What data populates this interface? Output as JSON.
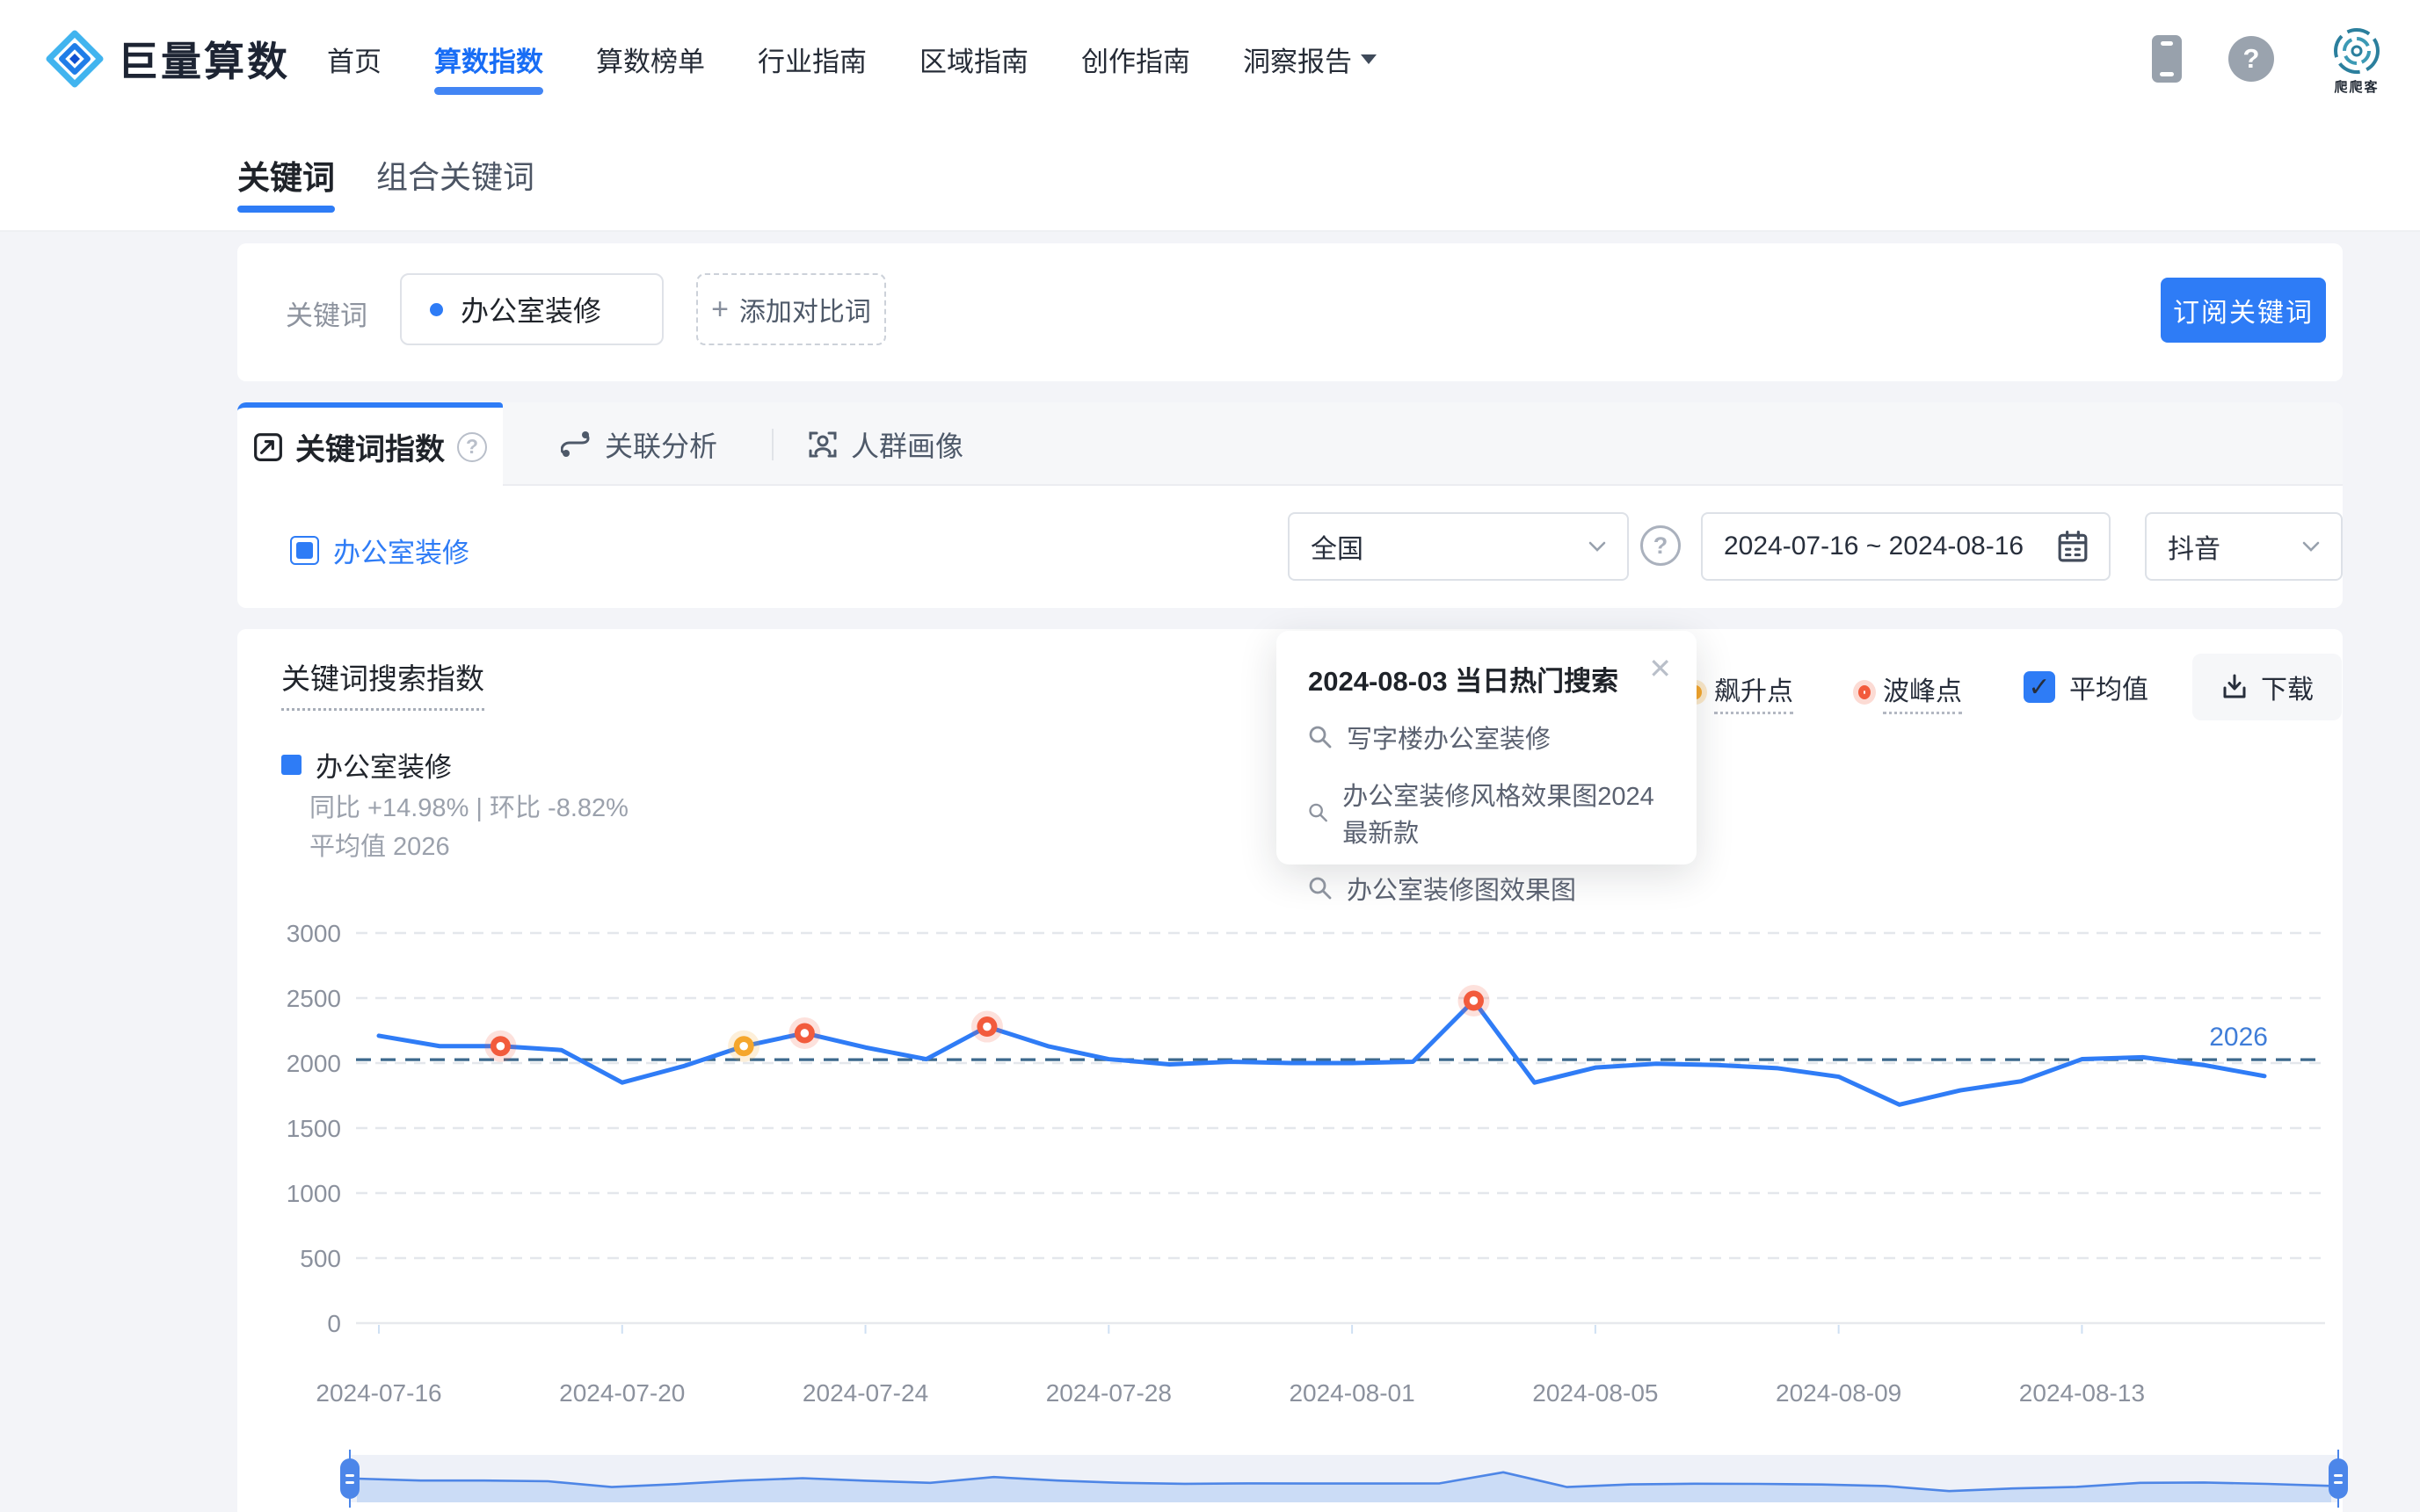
{
  "header": {
    "logo_text": "巨量算数",
    "nav_items": [
      {
        "label": "首页",
        "active": false
      },
      {
        "label": "算数指数",
        "active": true
      },
      {
        "label": "算数榜单",
        "active": false
      },
      {
        "label": "行业指南",
        "active": false
      },
      {
        "label": "区域指南",
        "active": false
      },
      {
        "label": "创作指南",
        "active": false
      },
      {
        "label": "洞察报告",
        "active": false,
        "has_caret": true
      }
    ],
    "badge_text": "爬爬客"
  },
  "icons": {
    "help_glyph": "?",
    "close_glyph": "✕",
    "check_glyph": "✓",
    "plus_glyph": "+"
  },
  "page_tabs": [
    {
      "label": "关键词",
      "active": true
    },
    {
      "label": "组合关键词",
      "active": false
    }
  ],
  "keyword_bar": {
    "label": "关键词",
    "keyword": "办公室装修",
    "add_compare_label": "添加对比词",
    "subscribe_label": "订阅关键词"
  },
  "index_tabs": [
    {
      "label": "关键词指数",
      "active": true
    },
    {
      "label": "关联分析",
      "active": false
    },
    {
      "label": "人群画像",
      "active": false
    }
  ],
  "filters": {
    "series_legend": "办公室装修",
    "region": "全国",
    "date_range": "2024-07-16 ~ 2024-08-16",
    "platform": "抖音"
  },
  "chart_header": {
    "title": "关键词搜索指数",
    "legend_rise": "飙升点",
    "legend_peak": "波峰点",
    "average_checkbox": "平均值",
    "download_label": "下载"
  },
  "series_info": {
    "name": "办公室装修",
    "stats": "同比 +14.98% | 环比 -8.82%",
    "average_text": "平均值 2026"
  },
  "hot_search_popup": {
    "title": "2024-08-03 当日热门搜索",
    "items": [
      "写字楼办公室装修",
      "办公室装修风格效果图2024最新款",
      "办公室装修图效果图"
    ]
  },
  "chart_data": {
    "type": "line",
    "title": "关键词搜索指数",
    "x": [
      "2024-07-16",
      "2024-07-17",
      "2024-07-18",
      "2024-07-19",
      "2024-07-20",
      "2024-07-21",
      "2024-07-22",
      "2024-07-23",
      "2024-07-24",
      "2024-07-25",
      "2024-07-26",
      "2024-07-27",
      "2024-07-28",
      "2024-07-29",
      "2024-07-30",
      "2024-07-31",
      "2024-08-01",
      "2024-08-02",
      "2024-08-03",
      "2024-08-04",
      "2024-08-05",
      "2024-08-06",
      "2024-08-07",
      "2024-08-08",
      "2024-08-09",
      "2024-08-10",
      "2024-08-11",
      "2024-08-12",
      "2024-08-13",
      "2024-08-14",
      "2024-08-15",
      "2024-08-16"
    ],
    "series": [
      {
        "name": "办公室装修",
        "values": [
          2210,
          2130,
          2130,
          2100,
          1850,
          1975,
          2130,
          2230,
          2120,
          2030,
          2280,
          2130,
          2030,
          1990,
          2010,
          2000,
          2000,
          2010,
          2480,
          1850,
          1965,
          1995,
          1985,
          1960,
          1895,
          1680,
          1790,
          1860,
          2030,
          2045,
          1985,
          1900
        ]
      }
    ],
    "average": 2026,
    "ylim": [
      0,
      3000
    ],
    "yticks": [
      0,
      500,
      1000,
      1500,
      2000,
      2500,
      3000
    ],
    "xtick_labels": [
      "2024-07-16",
      "2024-07-20",
      "2024-07-24",
      "2024-07-28",
      "2024-08-01",
      "2024-08-05",
      "2024-08-09",
      "2024-08-13"
    ],
    "markers": [
      {
        "date": "2024-07-18",
        "index": 2,
        "type": "peak"
      },
      {
        "date": "2024-07-22",
        "index": 6,
        "type": "rise"
      },
      {
        "date": "2024-07-23",
        "index": 7,
        "type": "peak"
      },
      {
        "date": "2024-07-26",
        "index": 10,
        "type": "peak"
      },
      {
        "date": "2024-08-03",
        "index": 18,
        "type": "peak"
      }
    ],
    "grid": true,
    "legend_position": "top-right",
    "colors": {
      "line": "#2f7cf6",
      "rise": "#f5a62c",
      "peak": "#f25b3c",
      "average_line": "#3c688c",
      "average_label": "#3f7dd8",
      "grid_line": "#e4e7ec",
      "axis_line": "#e7e9ed"
    }
  }
}
